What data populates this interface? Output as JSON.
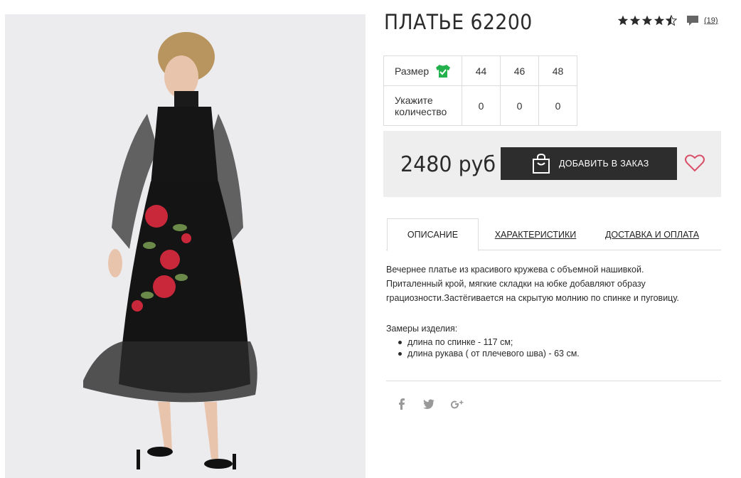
{
  "product": {
    "title": "ПЛАТЬЕ 62200",
    "rating": 4.5,
    "review_count": "(19)"
  },
  "sizes_table": {
    "size_label": "Размер",
    "qty_label_line1": "Укажите",
    "qty_label_line2": "количество",
    "sizes": [
      "44",
      "46",
      "48"
    ],
    "quantities": [
      "0",
      "0",
      "0"
    ]
  },
  "buy": {
    "price": "2480 руб",
    "add_button_label": "ДОБАВИТЬ В ЗАКАЗ"
  },
  "tabs": [
    {
      "label": "ОПИСАНИЕ",
      "active": true
    },
    {
      "label": "ХАРАКТЕРИСТИКИ",
      "active": false
    },
    {
      "label": "ДОСТАВКА И ОПЛАТА",
      "active": false
    }
  ],
  "description": {
    "line1": "Вечернее платье из красивого кружева с объемной нашивкой.",
    "line2": "Приталенный крой, мягкие складки на юбке добавляют образу",
    "line3": "грациозности.Застёгивается на скрытую молнию по спинке и пуговицу.",
    "measures_title": "Замеры изделия:",
    "measures": [
      "длина по спинке - 117 см;",
      "длина рукава ( от плечевого шва) - 63 см."
    ]
  },
  "social": [
    "facebook-icon",
    "twitter-icon",
    "google-plus-icon"
  ],
  "colors": {
    "accent_heart": "#d9506a",
    "shirt_icon": "#22b14c",
    "button_bg": "#2d2d2d",
    "star": "#2b2b2b"
  }
}
